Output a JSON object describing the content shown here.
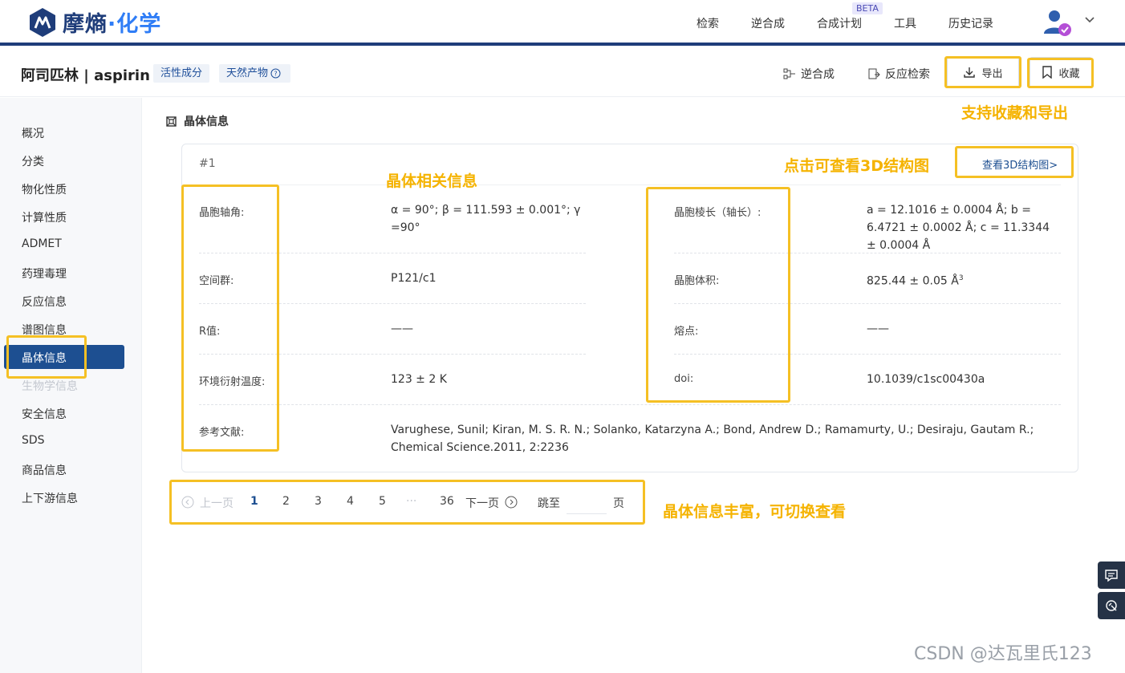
{
  "app": {
    "brand_part1": "摩熵",
    "brand_dot": "·",
    "brand_part2": "化学",
    "nav": [
      "检索",
      "逆合成",
      "合成计划",
      "工具",
      "历史记录"
    ],
    "beta_badge": "BETA"
  },
  "compound": {
    "title": "阿司匹林 | aspirin",
    "tags": [
      "活性成分",
      "天然产物"
    ]
  },
  "title_actions": {
    "retro": "逆合成",
    "reaction_search": "反应检索",
    "export": "导出",
    "favorite": "收藏"
  },
  "sidebar": {
    "items": [
      "概况",
      "分类",
      "物化性质",
      "计算性质",
      "ADMET",
      "药理毒理",
      "反应信息",
      "谱图信息",
      "晶体信息",
      "生物学信息",
      "安全信息",
      "SDS",
      "商品信息",
      "上下游信息"
    ],
    "active_index": 8,
    "disabled_index": 9
  },
  "section": {
    "title": "晶体信息"
  },
  "crystal": {
    "index": "#1",
    "view_3d": "查看3D结构图>",
    "rows": [
      {
        "left_label": "晶胞轴角:",
        "left_value": "α = 90°; β = 111.593 ± 0.001°; γ =90°",
        "right_label": "晶胞棱长（轴长）:",
        "right_value": "a = 12.1016 ± 0.0004 Å; b = 6.4721 ± 0.0002 Å; c = 11.3344 ± 0.0004 Å"
      },
      {
        "left_label": "空间群:",
        "left_value": "P121/c1",
        "right_label": "晶胞体积:",
        "right_value": "825.44 ± 0.05 Å",
        "right_value_sup": "3"
      },
      {
        "left_label": "R值:",
        "left_value": "——",
        "right_label": "熔点:",
        "right_value": "——"
      },
      {
        "left_label": "环境衍射温度:",
        "left_value": "123 ± 2 K",
        "right_label": "doi:",
        "right_value": "10.1039/c1sc00430a"
      }
    ],
    "reference_label": "参考文献:",
    "reference_value": "Varughese, Sunil; Kiran, M. S. R. N.; Solanko, Katarzyna A.; Bond, Andrew D.; Ramamurty, U.; Desiraju, Gautam R.; Chemical Science.2011, 2:2236"
  },
  "pagination": {
    "prev": "上一页",
    "pages": [
      "1",
      "2",
      "3",
      "4",
      "5"
    ],
    "ellipsis": "···",
    "last": "36",
    "next": "下一页",
    "jump_label": "跳至",
    "page_suffix": "页",
    "current": "1"
  },
  "annotations": {
    "favorite_export": "支持收藏和导出",
    "view_3d": "点击可查看3D结构图",
    "crystal_info": "晶体相关信息",
    "switch": "晶体信息丰富，可切换查看"
  },
  "watermark": "CSDN @达瓦里氏123",
  "colors": {
    "primary": "#1d4f91",
    "brand_dark": "#1f3d7a",
    "brand_light": "#2f7df6",
    "highlight": "#f5c024",
    "annotation_text": "#f5b300"
  }
}
